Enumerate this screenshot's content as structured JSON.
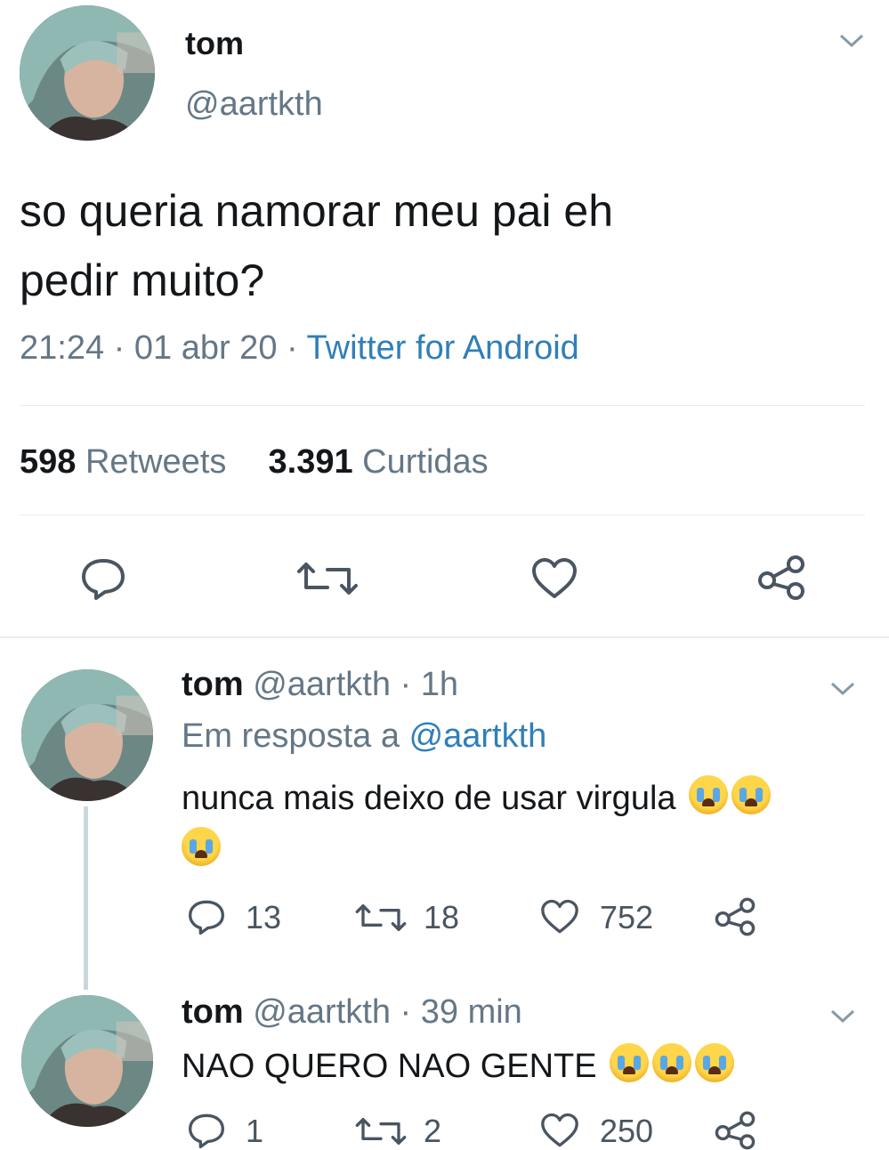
{
  "tweet": {
    "display_name": "tom",
    "handle": "@aartkth",
    "text_line1": "so queria namorar meu pai eh",
    "text_line2": "pedir muito?",
    "time": "21:24",
    "date": "01 abr 20",
    "source": "Twitter for Android",
    "retweets_count": "598",
    "retweets_label": "Retweets",
    "likes_count": "3.391",
    "likes_label": "Curtidas"
  },
  "replies": [
    {
      "display_name": "tom",
      "handle": "@aartkth",
      "time_ago": "1h",
      "reply_prefix": "Em resposta a",
      "reply_to": "@aartkth",
      "text": "nunca mais deixo de usar virgula",
      "emoji_name": "loudly-crying-face",
      "reply_count": "13",
      "retweet_count": "18",
      "like_count": "752"
    },
    {
      "display_name": "tom",
      "handle": "@aartkth",
      "time_ago": "39 min",
      "text": "NAO QUERO NAO GENTE",
      "emoji_name": "loudly-crying-face",
      "reply_count": "1",
      "retweet_count": "2",
      "like_count": "250"
    }
  ],
  "colors": {
    "link": "#2f7fb8",
    "muted": "#657786",
    "divider": "#e6ecf0"
  }
}
